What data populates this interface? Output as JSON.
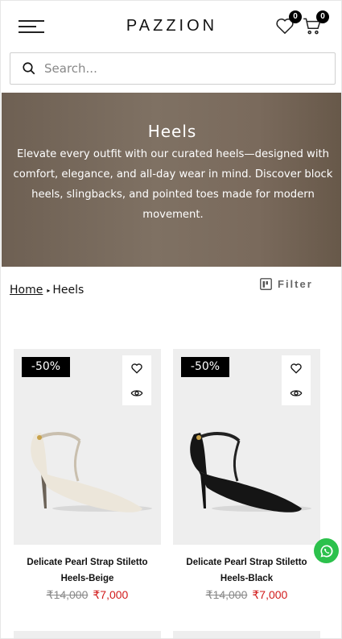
{
  "header": {
    "brand": "PAZZION",
    "wishlist_count": "0",
    "cart_count": "0"
  },
  "search": {
    "placeholder": "Search..."
  },
  "hero": {
    "title": "Heels",
    "description": "Elevate every outfit with our curated heels—designed with comfort, elegance, and all-day wear in mind. Discover block heels, slingbacks, and pointed toes made for modern movement."
  },
  "breadcrumb": {
    "home": "Home",
    "current": "Heels"
  },
  "filter": {
    "label": "Filter"
  },
  "products": [
    {
      "discount": "-50%",
      "name": "Delicate Pearl Strap Stiletto Heels-Beige",
      "old_price": "₹14,000",
      "price": "₹7,000",
      "shoe_color": "#ece6da"
    },
    {
      "discount": "-50%",
      "name": "Delicate Pearl Strap Stiletto Heels-Black",
      "old_price": "₹14,000",
      "price": "₹7,000",
      "shoe_color": "#151515"
    }
  ],
  "colors": {
    "accent_price": "#d11a1a",
    "whatsapp": "#2cc14c",
    "hero_bg": "#7a6b5d"
  },
  "icons": [
    "menu-icon",
    "heart-icon",
    "cart-icon",
    "search-icon",
    "filter-icon",
    "eye-icon",
    "whatsapp-icon"
  ]
}
